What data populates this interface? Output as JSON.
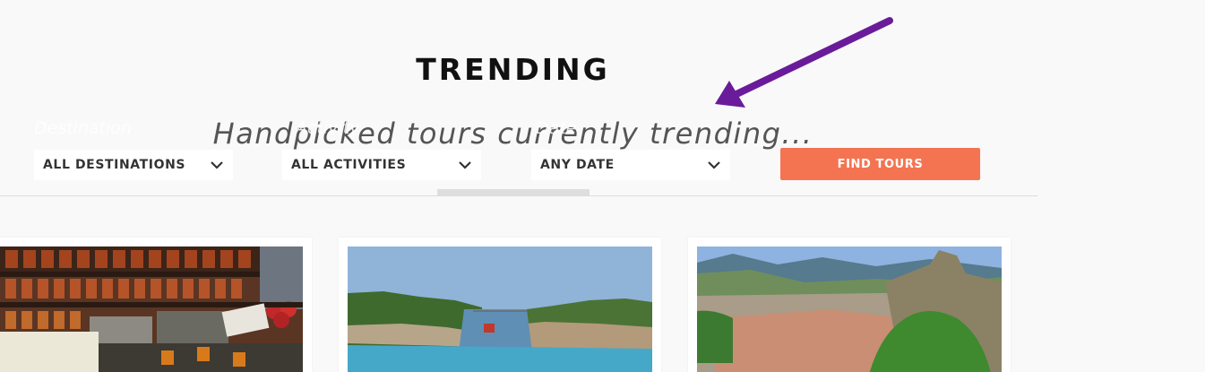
{
  "section": {
    "title": "TRENDING",
    "subtitle": "Handpicked tours currently trending..."
  },
  "search": {
    "destination_label": "Destination",
    "destination_value": "ALL DESTINATIONS",
    "activity_label": "Activity",
    "activity_value": "ALL ACTIVITIES",
    "date_label": "Date",
    "date_value": "ANY DATE",
    "find_button": "FIND TOURS"
  },
  "tours": [
    {
      "image": "greek-market-spices-photo"
    },
    {
      "image": "corinth-canal-photo"
    },
    {
      "image": "meteora-kalambaka-photo"
    }
  ],
  "colors": {
    "accent": "#f47452",
    "annotation_arrow": "#6a1b9a",
    "background": "#f9f9f9"
  }
}
